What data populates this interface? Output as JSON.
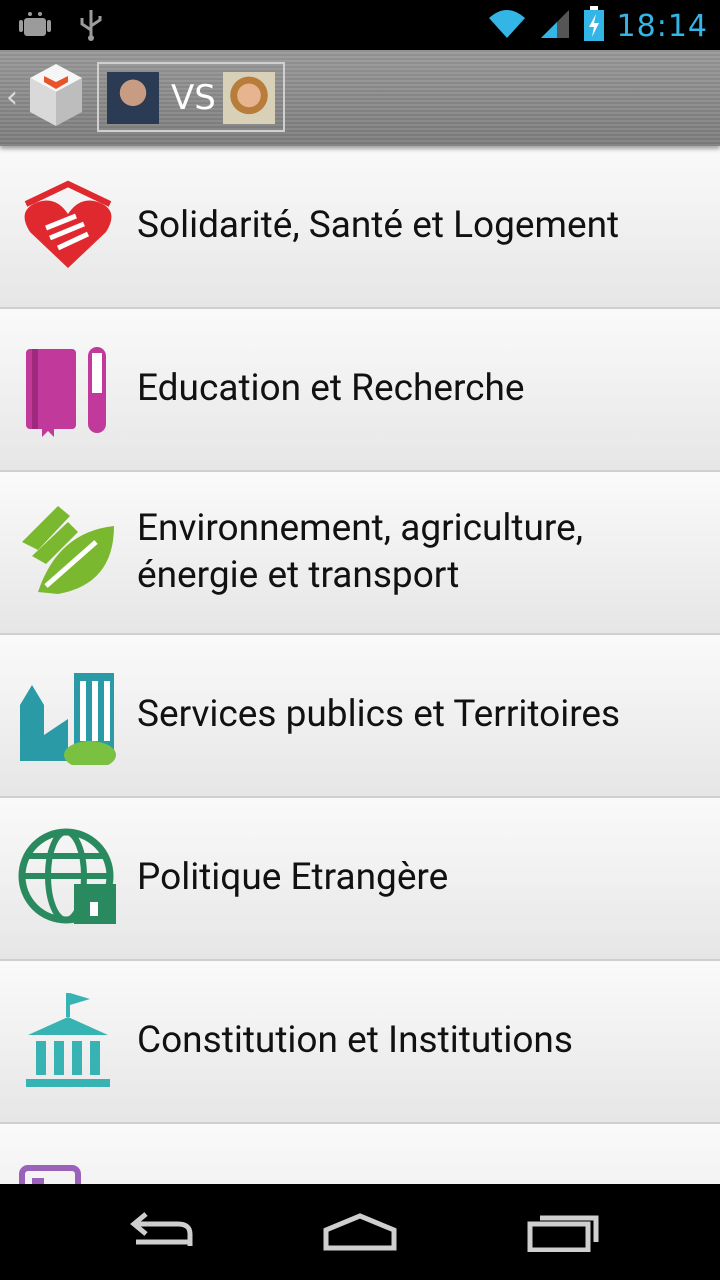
{
  "status_bar": {
    "time": "18:14"
  },
  "action_bar": {
    "vs_label": "VS"
  },
  "categories": [
    {
      "label": "Solidarité, Santé et Logement",
      "icon": "heart-hands-icon",
      "color": "#e0282f"
    },
    {
      "label": "Education et Recherche",
      "icon": "book-testtube-icon",
      "color": "#c0399b"
    },
    {
      "label": "Environnement, agriculture, énergie et transport",
      "icon": "leaf-hand-icon",
      "color": "#7ab82f"
    },
    {
      "label": "Services publics et Territoires",
      "icon": "town-icon",
      "color": "#2a9aa6"
    },
    {
      "label": "Politique Etrangère",
      "icon": "globe-castle-icon",
      "color": "#2a8a5f"
    },
    {
      "label": "Constitution et Institutions",
      "icon": "institution-icon",
      "color": "#38b3b3"
    }
  ]
}
